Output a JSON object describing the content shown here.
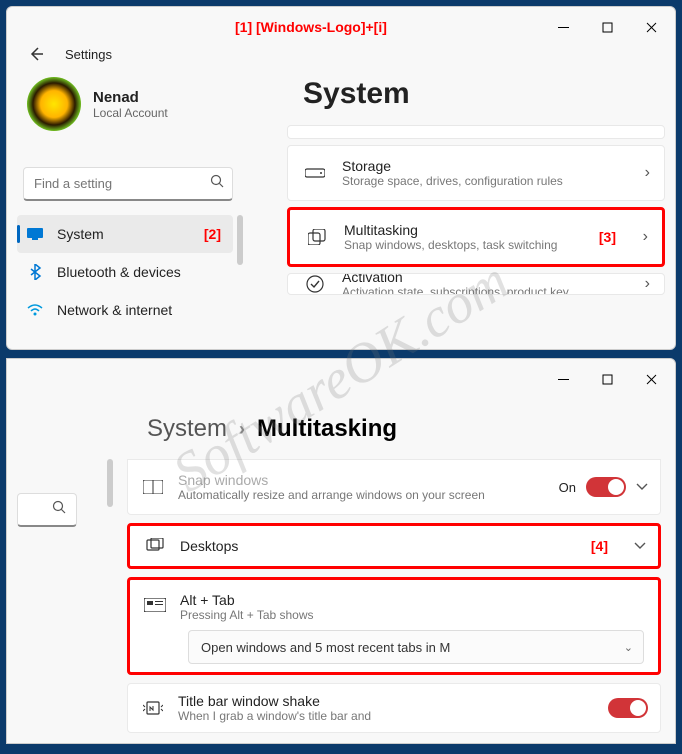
{
  "annotations": {
    "a1": "[1] [Windows-Logo]+[i]",
    "a2": "[2]",
    "a3": "[3]",
    "a4": "[4]"
  },
  "window1": {
    "app_title": "Settings",
    "user": {
      "name": "Nenad",
      "account_type": "Local Account"
    },
    "heading": "System",
    "search_placeholder": "Find a setting",
    "sidebar": [
      {
        "label": "System"
      },
      {
        "label": "Bluetooth & devices"
      },
      {
        "label": "Network & internet"
      }
    ],
    "cards": {
      "storage": {
        "title": "Storage",
        "sub": "Storage space, drives, configuration rules"
      },
      "multitask": {
        "title": "Multitasking",
        "sub": "Snap windows, desktops, task switching"
      },
      "activation": {
        "title": "Activation",
        "sub": "Activation state, subscriptions, product key"
      }
    }
  },
  "window2": {
    "breadcrumb": {
      "parent": "System",
      "current": "Multitasking"
    },
    "rows": {
      "snap": {
        "title": "Snap windows",
        "sub": "Automatically resize and arrange windows on your screen",
        "state": "On"
      },
      "desktops": {
        "title": "Desktops"
      },
      "alttab": {
        "title": "Alt + Tab",
        "sub": "Pressing Alt + Tab shows",
        "selected": "Open windows and 5 most recent tabs in M"
      },
      "shake": {
        "title": "Title bar window shake",
        "sub": "When I grab a window's title bar and"
      }
    }
  },
  "watermark": "SoftwareOK.com"
}
